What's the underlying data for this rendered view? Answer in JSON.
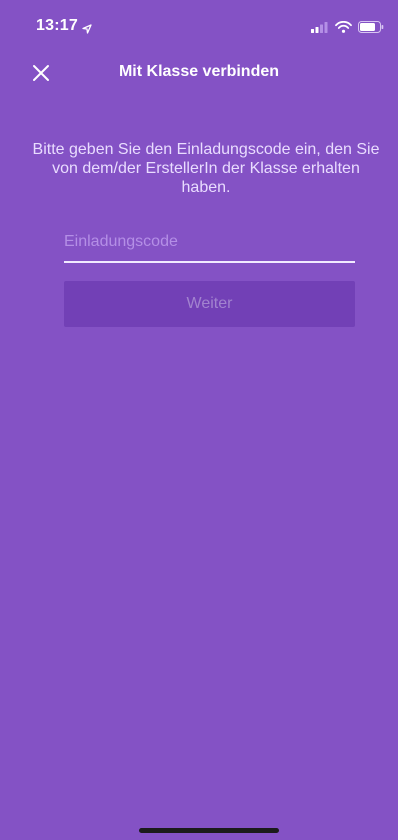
{
  "status_bar": {
    "time": "13:17",
    "icons": [
      "location-arrow-icon",
      "cellular-signal-icon",
      "wifi-icon",
      "battery-icon"
    ]
  },
  "nav": {
    "title": "Mit Klasse verbinden",
    "close_icon": "close-icon"
  },
  "main": {
    "instructions": "Bitte geben Sie den Einladungscode ein, den Sie von dem/der ErstellerIn der Klasse erhalten haben.",
    "code_field": {
      "placeholder": "Einladungscode",
      "value": ""
    },
    "next_button_label": "Weiter"
  },
  "colors": {
    "background": "#8452c5",
    "button_disabled": "#7240b6",
    "button_text_disabled": "#a283cf",
    "placeholder": "#b48fe6"
  }
}
